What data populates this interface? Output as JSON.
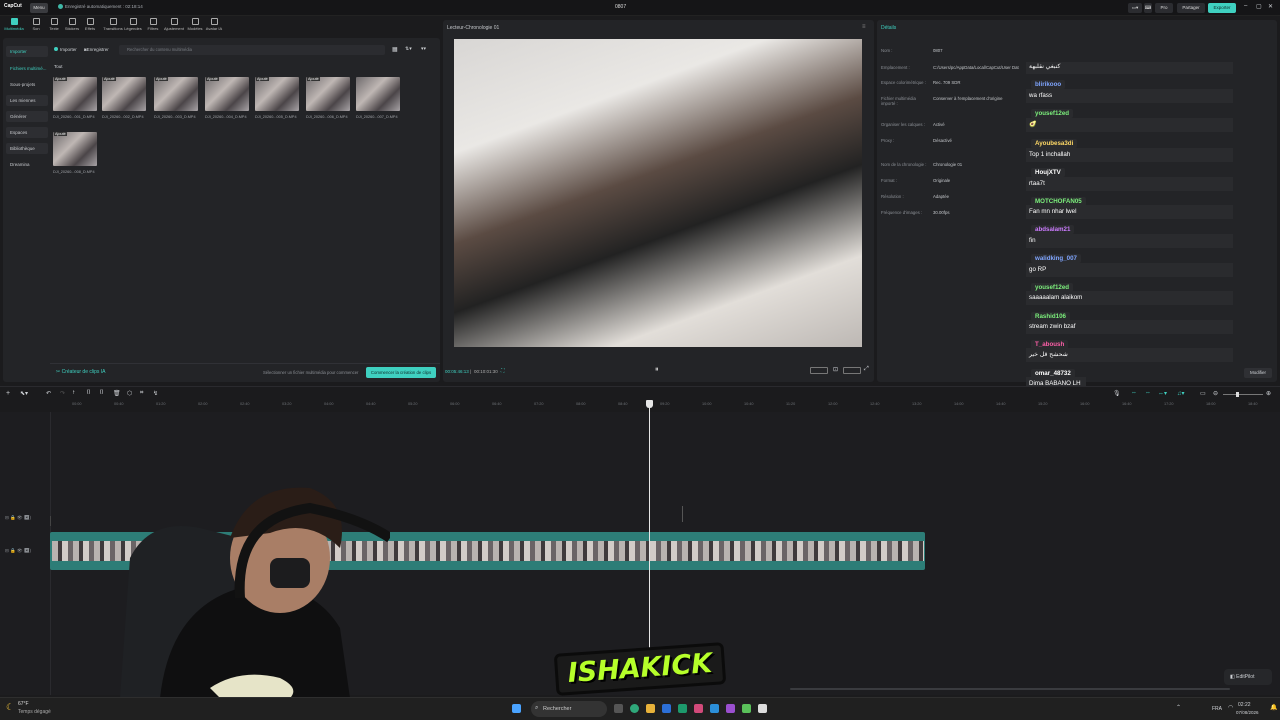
{
  "topbar": {
    "app_logo": "CapCut",
    "menu_label": "Menu",
    "autosave_text": "Enregistré automatiquement : 02:18:14",
    "project_title": "0807",
    "pro_label": "Pro",
    "share_label": "Partager",
    "export_label": "Exporter"
  },
  "toolbar": {
    "items": [
      "Multimédia",
      "Son",
      "Texte",
      "Stickers",
      "Effets",
      "Transitions",
      "Légendes",
      "Filtres",
      "Ajustement",
      "Modèles",
      "Avatar IA"
    ]
  },
  "left_panel": {
    "categories": [
      "Importer",
      "Fichiers multimé...",
      "Sous-projets",
      "Les miennes",
      "Générer",
      "Espaces",
      "Bibliothèque",
      "Dreamina"
    ],
    "import_label": "Importer",
    "record_label": "Enregistrer",
    "search_placeholder": "Rechercher du contenu multimédia",
    "all_label": "Tout",
    "badge_label": "Ajouté",
    "media_files": [
      "DJI_20260...001_D.MP4",
      "DJI_20260...002_D.MP4",
      "DJI_20260...003_D.MP4",
      "DJI_20260...004_D.MP4",
      "DJI_20260...005_D.MP4",
      "DJI_20260...006_D.MP4",
      "DJI_20260...007_D.MP4",
      "DJI_20260...008_D.MP4"
    ],
    "clip_creator_label": "Créateur de clips IA",
    "select_hint": "Sélectionner un fichier multimédia pour commencer",
    "start_button": "Commencer la création de clips"
  },
  "player": {
    "title": "Lecteur-Chronologie 01",
    "current_time": "00:05:46:13",
    "total_time": "00:10:01:30"
  },
  "details": {
    "header": "Détails",
    "rows": [
      {
        "label": "Nom :",
        "value": "0807"
      },
      {
        "label": "Emplacement :",
        "value": "C:/Users/pc/AppData/Local/CapCut/User Dat"
      },
      {
        "label": "Espace colorimétrique :",
        "value": "Rec. 709 SDR"
      },
      {
        "label": "Fichier multimédia importé :",
        "value": "Conserver à l'emplacement d'origine"
      },
      {
        "label": "Organiser les calques :",
        "value": "Activé"
      },
      {
        "label": "Proxy :",
        "value": "Désactivé"
      },
      {
        "label": "Nom de la chronologie :",
        "value": "Chronologie 01"
      },
      {
        "label": "Format :",
        "value": "Originale"
      },
      {
        "label": "Résolution :",
        "value": "Adaptée"
      },
      {
        "label": "Fréquence d'images :",
        "value": "30.00fps"
      }
    ],
    "modify_button": "Modifier"
  },
  "chat": [
    {
      "name": "",
      "message": "كنبغي نقلبهة",
      "color": "#ffffff"
    },
    {
      "name": "blirikooo",
      "message": "wa rfass",
      "color": "#7fa5ff"
    },
    {
      "name": "yousef12ed",
      "message": "🥑",
      "color": "#7cf07c"
    },
    {
      "name": "Ayoubesa3di",
      "message": "Top 1 inchallah",
      "color": "#ffd966"
    },
    {
      "name": "HoujXTV",
      "message": "rtaa7t",
      "color": "#ffffff"
    },
    {
      "name": "MOTCHOFAN05",
      "message": "Fan mn nhar lwel",
      "color": "#7cf07c"
    },
    {
      "name": "abdsalam21",
      "message": "fin",
      "color": "#cc7bff"
    },
    {
      "name": "walidking_007",
      "message": "go RP",
      "color": "#7fa5ff"
    },
    {
      "name": "yousef12ed",
      "message": "saaaaalam alaikom",
      "color": "#7cf07c"
    },
    {
      "name": "Rashid106",
      "message": "stream zwin bzaf",
      "color": "#7cf07c"
    },
    {
      "name": "T_aboush",
      "message": "شحشح قل خير",
      "color": "#ff5fa8"
    },
    {
      "name": "omar_48732",
      "message": "Dima BABANO LH",
      "color": "#ffffff"
    }
  ],
  "timeline": {
    "ticks": [
      "00:00",
      "00:40",
      "01:20",
      "02:00",
      "02:40",
      "03:20",
      "04:00",
      "04:40",
      "05:20",
      "06:00",
      "06:40",
      "07:20",
      "08:00",
      "08:40",
      "09:20",
      "10:00",
      "10:40",
      "11:20",
      "12:00",
      "12:40",
      "13:20",
      "14:00",
      "14:40",
      "15:20",
      "16:00",
      "16:40",
      "17:20",
      "18:00",
      "18:40",
      "19:20"
    ],
    "playhead_fraction": 0.486
  },
  "overlay": {
    "streamer_logo": "ISHAKICK",
    "editpilot_label": "EditPilot"
  },
  "taskbar": {
    "weather_temp": "67°F",
    "weather_text": "Temps dégagé",
    "search_label": "Rechercher",
    "lang": "FRA",
    "time": "02:22",
    "date": "07/08/2026"
  },
  "colors": {
    "accent": "#3fd0c0",
    "track": "#2d7d77"
  }
}
